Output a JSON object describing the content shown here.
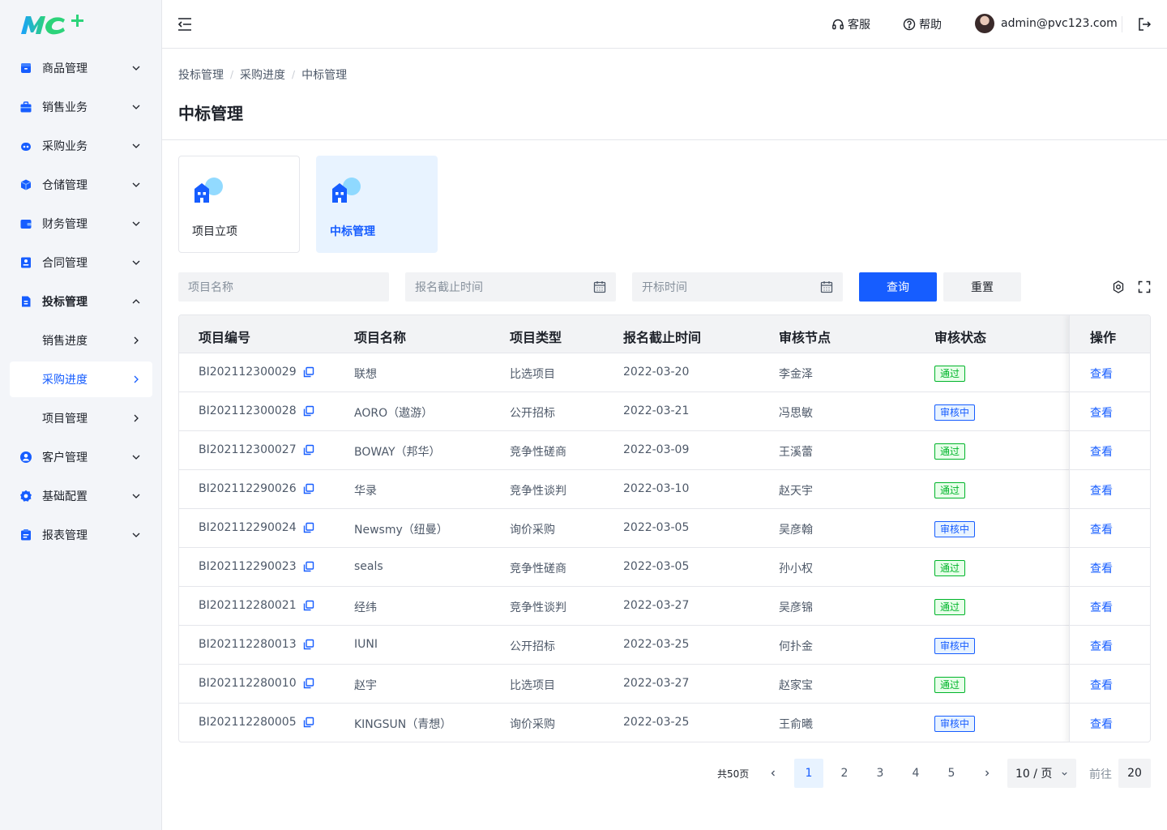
{
  "brand": {
    "logo_text": "MC+"
  },
  "sidebar": {
    "items": [
      {
        "label": "商品管理",
        "icon": "box-icon",
        "arrow": "down"
      },
      {
        "label": "销售业务",
        "icon": "briefcase-icon",
        "arrow": "down"
      },
      {
        "label": "采购业务",
        "icon": "robot-icon",
        "arrow": "down"
      },
      {
        "label": "仓储管理",
        "icon": "cube-icon",
        "arrow": "down"
      },
      {
        "label": "财务管理",
        "icon": "wallet-icon",
        "arrow": "down"
      },
      {
        "label": "合同管理",
        "icon": "contract-icon",
        "arrow": "down"
      },
      {
        "label": "投标管理",
        "icon": "bid-document-icon",
        "arrow": "up"
      },
      {
        "label": "销售进度",
        "icon": "",
        "arrow": "right"
      },
      {
        "label": "采购进度",
        "icon": "",
        "arrow": "right"
      },
      {
        "label": "项目管理",
        "icon": "",
        "arrow": "right"
      },
      {
        "label": "客户管理",
        "icon": "user-circle-icon",
        "arrow": "down"
      },
      {
        "label": "基础配置",
        "icon": "settings-icon",
        "arrow": "down"
      },
      {
        "label": "报表管理",
        "icon": "report-icon",
        "arrow": "down"
      }
    ]
  },
  "header": {
    "service_label": "客服",
    "help_label": "帮助",
    "user_email": "admin@pvc123.com"
  },
  "breadcrumb": [
    "投标管理",
    "采购进度",
    "中标管理"
  ],
  "page_title": "中标管理",
  "cards": [
    {
      "label": "项目立项"
    },
    {
      "label": "中标管理"
    }
  ],
  "filters": {
    "project_name_placeholder": "项目名称",
    "signup_deadline_placeholder": "报名截止时间",
    "bid_open_time_placeholder": "开标时间",
    "query_label": "查询",
    "reset_label": "重置"
  },
  "table": {
    "columns": [
      "项目编号",
      "项目名称",
      "项目类型",
      "报名截止时间",
      "审核节点",
      "审核状态",
      "操作"
    ],
    "action_label": "查看",
    "rows": [
      {
        "code": "BI202112300029",
        "name": "联想",
        "type": "比选项目",
        "deadline": "2022-03-20",
        "node": "李金泽",
        "status": "通过",
        "status_kind": "pass"
      },
      {
        "code": "BI202112300028",
        "name": "AORO（遨游）",
        "type": "公开招标",
        "deadline": "2022-03-21",
        "node": "冯思敏",
        "status": "审核中",
        "status_kind": "review"
      },
      {
        "code": "BI202112300027",
        "name": "BOWAY（邦华）",
        "type": "竞争性磋商",
        "deadline": "2022-03-09",
        "node": "王溪蕾",
        "status": "通过",
        "status_kind": "pass"
      },
      {
        "code": "BI202112290026",
        "name": "华录",
        "type": "竞争性谈判",
        "deadline": "2022-03-10",
        "node": "赵天宇",
        "status": "通过",
        "status_kind": "pass"
      },
      {
        "code": "BI202112290024",
        "name": "Newsmy（纽曼）",
        "type": "询价采购",
        "deadline": "2022-03-05",
        "node": "吴彦翰",
        "status": "审核中",
        "status_kind": "review"
      },
      {
        "code": "BI202112290023",
        "name": "seals",
        "type": "竞争性磋商",
        "deadline": "2022-03-05",
        "node": "孙小权",
        "status": "通过",
        "status_kind": "pass"
      },
      {
        "code": "BI202112280021",
        "name": "经纬",
        "type": "竞争性谈判",
        "deadline": "2022-03-27",
        "node": "吴彦锦",
        "status": "通过",
        "status_kind": "pass"
      },
      {
        "code": "BI202112280013",
        "name": "IUNI",
        "type": "公开招标",
        "deadline": "2022-03-25",
        "node": "何扑金",
        "status": "审核中",
        "status_kind": "review"
      },
      {
        "code": "BI202112280010",
        "name": "赵宇",
        "type": "比选项目",
        "deadline": "2022-03-27",
        "node": "赵家宝",
        "status": "通过",
        "status_kind": "pass"
      },
      {
        "code": "BI202112280005",
        "name": "KINGSUN（青想）",
        "type": "询价采购",
        "deadline": "2022-03-25",
        "node": "王俞曦",
        "status": "审核中",
        "status_kind": "review"
      }
    ]
  },
  "pagination": {
    "total_label": "共50页",
    "pages": [
      "1",
      "2",
      "3",
      "4",
      "5"
    ],
    "current": "1",
    "page_size_label": "10 / 页",
    "goto_label": "前往",
    "goto_value": "20"
  },
  "colors": {
    "primary": "#165dff",
    "pass": "#00b42a",
    "sidebar_bg": "#f3f5f9"
  }
}
